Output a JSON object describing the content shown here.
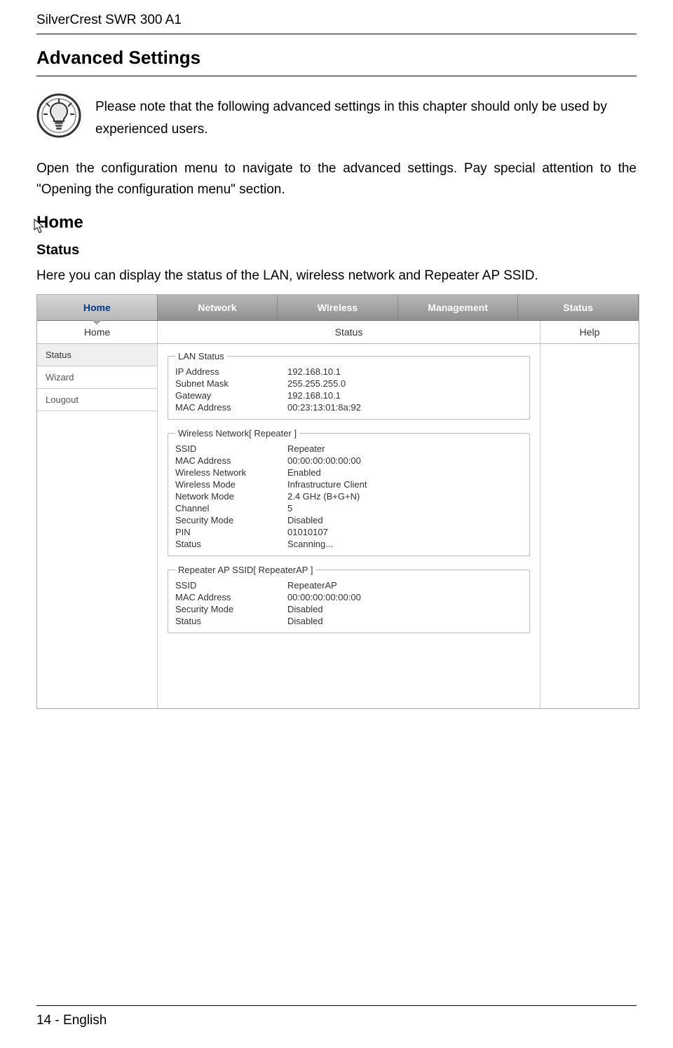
{
  "doc": {
    "product": "SilverCrest SWR 300 A1",
    "section_title": "Advanced Settings",
    "note": "Please note that the following advanced settings in this chapter should only be used by experienced users.",
    "intro": "Open the configuration menu to navigate to the advanced settings. Pay special attention to the \"Opening the configuration menu\" section.",
    "h3": "Home",
    "h4": "Status",
    "status_text": "Here you can display the status of the LAN, wireless network and Repeater AP SSID.",
    "page_footer": "14 - English"
  },
  "ui": {
    "tabs": [
      "Home",
      "Network",
      "Wireless",
      "Management",
      "Status"
    ],
    "active_tab_index": 0,
    "subhead": {
      "left": "Home",
      "mid": "Status",
      "right": "Help"
    },
    "sidebar": {
      "items": [
        "Status",
        "Wizard",
        "Lougout"
      ],
      "selected_index": 0
    },
    "groups": [
      {
        "legend": "LAN Status",
        "rows": [
          {
            "k": "IP Address",
            "v": "192.168.10.1"
          },
          {
            "k": "Subnet Mask",
            "v": "255.255.255.0"
          },
          {
            "k": "Gateway",
            "v": "192.168.10.1"
          },
          {
            "k": "MAC Address",
            "v": "00:23:13:01:8a:92"
          }
        ]
      },
      {
        "legend": "Wireless Network[ Repeater ]",
        "rows": [
          {
            "k": "SSID",
            "v": "Repeater"
          },
          {
            "k": "MAC Address",
            "v": "00:00:00:00:00:00"
          },
          {
            "k": "Wireless Network",
            "v": "Enabled"
          },
          {
            "k": "Wireless Mode",
            "v": "Infrastructure Client"
          },
          {
            "k": "Network Mode",
            "v": "2.4 GHz (B+G+N)"
          },
          {
            "k": "Channel",
            "v": "5"
          },
          {
            "k": "Security Mode",
            "v": "Disabled"
          },
          {
            "k": "PIN",
            "v": "01010107"
          },
          {
            "k": "Status",
            "v": "Scanning..."
          }
        ]
      },
      {
        "legend": "Repeater AP SSID[ RepeaterAP ]",
        "rows": [
          {
            "k": "SSID",
            "v": "RepeaterAP"
          },
          {
            "k": "MAC Address",
            "v": "00:00:00:00:00:00"
          },
          {
            "k": "Security Mode",
            "v": "Disabled"
          },
          {
            "k": "Status",
            "v": "Disabled"
          }
        ]
      }
    ]
  }
}
